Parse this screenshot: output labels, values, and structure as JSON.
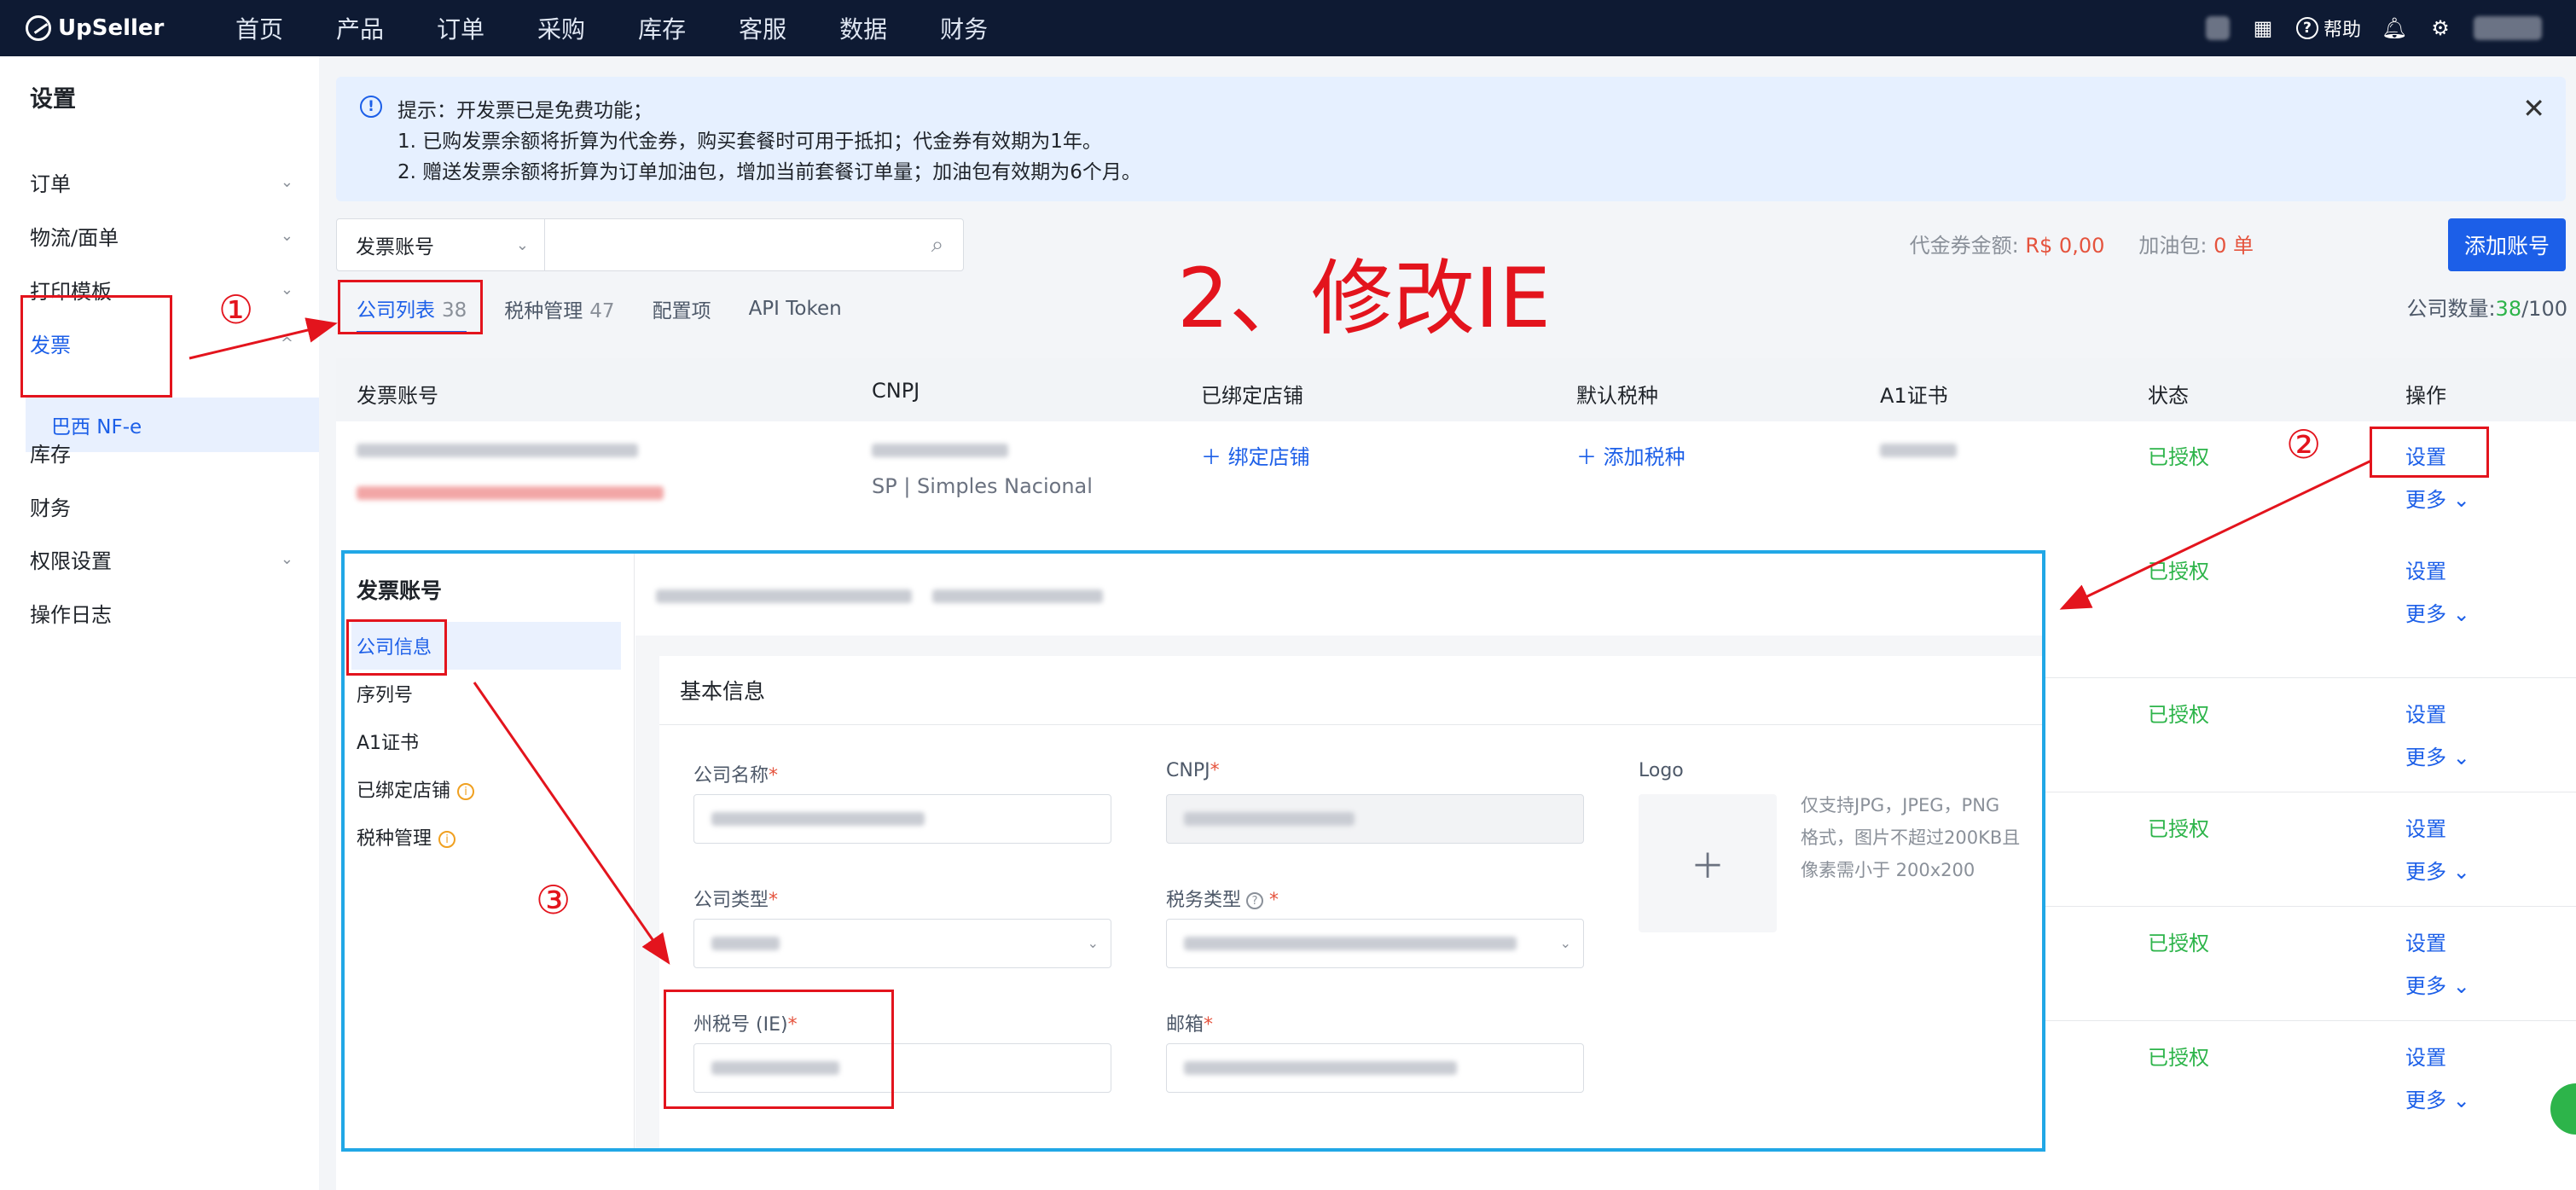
{
  "topbar": {
    "brand": "UpSeller",
    "nav": [
      "首页",
      "产品",
      "订单",
      "采购",
      "库存",
      "客服",
      "数据",
      "财务"
    ],
    "help": "帮助"
  },
  "sidebar": {
    "title": "设置",
    "items": [
      {
        "label": "订单",
        "expandable": true
      },
      {
        "label": "物流/面单",
        "expandable": true
      },
      {
        "label": "打印模板",
        "expandable": true
      },
      {
        "label": "发票",
        "expandable": true,
        "active": true
      },
      {
        "label": "库存",
        "expandable": false
      },
      {
        "label": "财务",
        "expandable": false
      },
      {
        "label": "权限设置",
        "expandable": true
      },
      {
        "label": "操作日志",
        "expandable": false
      }
    ],
    "sub_item": "巴西 NF-e"
  },
  "notice": {
    "line1": "提示：开发票已是免费功能；",
    "line2": "1. 已购发票余额将折算为代金券，购买套餐时可用于抵扣；代金券有效期为1年。",
    "line3": "2. 赠送发票余额将折算为订单加油包，增加当前套餐订单量；加油包有效期为6个月。"
  },
  "search": {
    "select_value": "发票账号",
    "placeholder": ""
  },
  "stats": {
    "voucher_label": "代金券金额:",
    "voucher_value": "R$ 0,00",
    "fuel_label": "加油包:",
    "fuel_value": "0 单",
    "add_button": "添加账号"
  },
  "tabs": [
    {
      "label": "公司列表",
      "count": "38",
      "active": true
    },
    {
      "label": "税种管理",
      "count": "47",
      "active": false
    },
    {
      "label": "配置项",
      "count": "",
      "active": false
    },
    {
      "label": "API Token",
      "count": "",
      "active": false
    }
  ],
  "company_count": {
    "label": "公司数量:",
    "used": "38",
    "total": "/100"
  },
  "annotation": {
    "title": "2、修改IE",
    "num1": "①",
    "num2": "②",
    "num3": "③"
  },
  "table": {
    "headers": [
      "发票账号",
      "CNPJ",
      "已绑定店铺",
      "默认税种",
      "A1证书",
      "状态",
      "操作"
    ],
    "first_row": {
      "cnpj_sub": "SP | Simples Nacional",
      "bind_store": "绑定店铺",
      "add_tax": "添加税种",
      "status": "已授权",
      "action": "设置",
      "more": "更多"
    },
    "rows": [
      {
        "status": "已授权",
        "action": "设置",
        "more": "更多"
      },
      {
        "status": "已授权",
        "action": "设置",
        "more": "更多"
      },
      {
        "status": "已授权",
        "action": "设置",
        "more": "更多"
      },
      {
        "status": "已授权",
        "action": "设置",
        "more": "更多"
      },
      {
        "status": "已授权",
        "action": "设置",
        "more": "更多"
      }
    ]
  },
  "detail": {
    "left_title": "发票账号",
    "menu": [
      "公司信息",
      "序列号",
      "A1证书",
      "已绑定店铺",
      "税种管理"
    ],
    "card_title": "基本信息",
    "fields": {
      "company_name": "公司名称",
      "cnpj": "CNPJ",
      "logo": "Logo",
      "company_type": "公司类型",
      "tax_type": "税务类型",
      "ie": "州税号 (IE)",
      "email": "邮箱"
    },
    "upload_hint": [
      "仅支持JPG，JPEG，PNG",
      "格式，图片不超过200KB且",
      "像素需小于 200x200"
    ]
  }
}
